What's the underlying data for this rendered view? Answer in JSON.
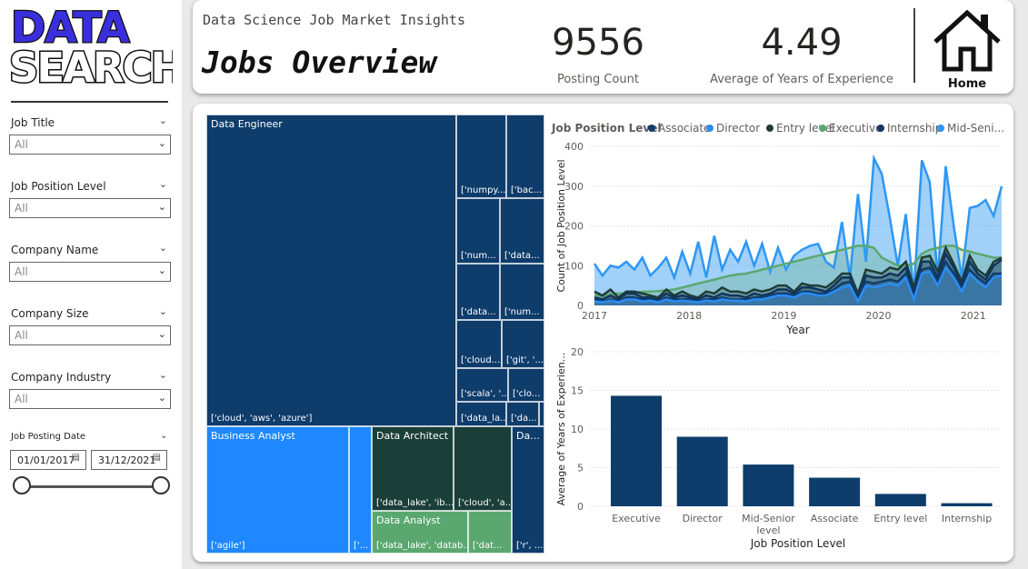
{
  "logo": {
    "line1": "DATA",
    "line2": "SEARCH"
  },
  "filters": {
    "job_title": {
      "label": "Job Title",
      "value": "All"
    },
    "position_level": {
      "label": "Job Position Level",
      "value": "All"
    },
    "company_name": {
      "label": "Company Name",
      "value": "All"
    },
    "company_size": {
      "label": "Company Size",
      "value": "All"
    },
    "company_industry": {
      "label": "Company Industry",
      "value": "All"
    },
    "posting_date": {
      "label": "Job Posting Date",
      "start": "01/01/2017",
      "end": "31/12/2021",
      "range_fraction": [
        0,
        1
      ]
    }
  },
  "header": {
    "subtitle": "Data Science Job Market Insights",
    "title": "Jobs Overview",
    "kpi_count": {
      "value": "9556",
      "label": "Posting Count"
    },
    "kpi_exp": {
      "value": "4.49",
      "label": "Average of Years of Experience"
    },
    "home_label": "Home"
  },
  "treemap": {
    "colors": {
      "navy": "#0e3c6b",
      "blue": "#1f88ff",
      "dark_green": "#1a3f38",
      "green": "#5aa86f"
    },
    "tiles": [
      {
        "label": "Data Engineer",
        "text": "['cloud', 'aws', 'azure']"
      },
      {
        "label": "",
        "text": "['numpy..."
      },
      {
        "label": "",
        "text": "['bac..."
      },
      {
        "label": "",
        "text": "['num..."
      },
      {
        "label": "",
        "text": "['data..."
      },
      {
        "label": "",
        "text": "['data..."
      },
      {
        "label": "",
        "text": "['num..."
      },
      {
        "label": "",
        "text": "['cloud..."
      },
      {
        "label": "",
        "text": "['git', '..."
      },
      {
        "label": "",
        "text": "['scala', '..."
      },
      {
        "label": "",
        "text": "['clo..."
      },
      {
        "label": "",
        "text": "['data_la..."
      },
      {
        "label": "",
        "text": "['da..."
      },
      {
        "label": "Business Analyst",
        "text": "['agile']"
      },
      {
        "label": "",
        "text": "['..."
      },
      {
        "label": "Data Architect",
        "text": "['data_lake', 'ib..."
      },
      {
        "label": "",
        "text": "['cloud', 'a..."
      },
      {
        "label": "Data Analyst",
        "text": "['data_lake', 'datab..."
      },
      {
        "label": "",
        "text": "['dat..."
      },
      {
        "label": "Da...",
        "text": "['r', ..."
      }
    ]
  },
  "line_chart": {
    "legend_title": "Job Position Level",
    "legend": [
      {
        "name": "Associate",
        "color": "#0f3e6d"
      },
      {
        "name": "Director",
        "color": "#2b8df4"
      },
      {
        "name": "Entry level",
        "color": "#1f3d37"
      },
      {
        "name": "Executive",
        "color": "#5aa86f"
      },
      {
        "name": "Internship",
        "color": "#12355e"
      },
      {
        "name": "Mid-Seni...",
        "color": "#2e97f2"
      }
    ]
  },
  "chart_data": [
    {
      "type": "area",
      "title": "",
      "xlabel": "Year",
      "ylabel": "Count of Job Position Level",
      "x_ticks": [
        "2017",
        "2018",
        "2019",
        "2020",
        "2021"
      ],
      "ylim": [
        0,
        400
      ],
      "y_ticks": [
        0,
        100,
        200,
        300,
        400
      ],
      "series": [
        {
          "name": "Mid-Seni...",
          "color": "#2e97f2",
          "values": [
            105,
            75,
            100,
            95,
            110,
            90,
            120,
            75,
            95,
            120,
            70,
            135,
            80,
            160,
            70,
            175,
            90,
            140,
            110,
            160,
            100,
            155,
            85,
            145,
            90,
            125,
            140,
            150,
            155,
            110,
            95,
            210,
            70,
            280,
            110,
            370,
            330,
            220,
            100,
            230,
            30,
            365,
            310,
            70,
            350,
            200,
            70,
            245,
            250,
            265,
            225,
            300
          ]
        },
        {
          "name": "Executive",
          "color": "#5aa86f",
          "values": [
            25,
            25,
            28,
            30,
            30,
            32,
            34,
            35,
            36,
            38,
            40,
            45,
            50,
            55,
            60,
            65,
            70,
            75,
            78,
            80,
            85,
            90,
            95,
            100,
            105,
            110,
            115,
            120,
            125,
            130,
            135,
            140,
            145,
            150,
            150,
            145,
            120,
            110,
            100,
            100,
            105,
            130,
            140,
            145,
            150,
            150,
            140,
            135,
            130,
            125,
            120,
            120
          ]
        },
        {
          "name": "Entry level",
          "color": "#1f3d37",
          "values": [
            35,
            25,
            40,
            20,
            35,
            35,
            30,
            25,
            20,
            40,
            25,
            35,
            25,
            20,
            35,
            30,
            45,
            35,
            35,
            30,
            40,
            35,
            40,
            50,
            50,
            35,
            55,
            50,
            50,
            45,
            60,
            80,
            80,
            30,
            90,
            85,
            80,
            95,
            90,
            110,
            45,
            120,
            125,
            85,
            145,
            105,
            60,
            125,
            90,
            75,
            110,
            120
          ]
        },
        {
          "name": "Internship",
          "color": "#12355e",
          "values": [
            20,
            15,
            25,
            15,
            30,
            30,
            20,
            20,
            15,
            30,
            20,
            25,
            20,
            15,
            25,
            20,
            30,
            25,
            25,
            20,
            30,
            25,
            30,
            40,
            40,
            30,
            45,
            45,
            40,
            35,
            50,
            70,
            70,
            20,
            75,
            70,
            70,
            80,
            75,
            95,
            30,
            110,
            110,
            70,
            130,
            95,
            50,
            110,
            80,
            65,
            100,
            115
          ]
        },
        {
          "name": "Associate",
          "color": "#0f3e6d",
          "values": [
            15,
            10,
            15,
            10,
            20,
            20,
            15,
            15,
            10,
            20,
            15,
            15,
            15,
            10,
            15,
            15,
            20,
            15,
            15,
            15,
            20,
            20,
            25,
            30,
            30,
            25,
            35,
            35,
            30,
            30,
            40,
            55,
            60,
            15,
            60,
            55,
            60,
            65,
            60,
            80,
            20,
            90,
            95,
            60,
            110,
            80,
            40,
            90,
            70,
            55,
            80,
            80
          ]
        },
        {
          "name": "Director",
          "color": "#2b8df4",
          "values": [
            10,
            8,
            12,
            8,
            15,
            15,
            10,
            12,
            8,
            15,
            10,
            12,
            10,
            8,
            12,
            10,
            15,
            12,
            12,
            10,
            15,
            15,
            20,
            25,
            25,
            20,
            30,
            30,
            25,
            25,
            35,
            45,
            50,
            10,
            50,
            45,
            50,
            55,
            50,
            70,
            15,
            80,
            85,
            50,
            95,
            70,
            35,
            80,
            60,
            45,
            70,
            75
          ]
        }
      ]
    },
    {
      "type": "bar",
      "title": "",
      "xlabel": "Job Position Level",
      "ylabel": "Average of Years of Experien...",
      "categories": [
        "Executive",
        "Director",
        "Mid-Senior level",
        "Associate",
        "Entry level",
        "Internship"
      ],
      "values": [
        14.3,
        9.0,
        5.4,
        3.7,
        1.6,
        0.4
      ],
      "ylim": [
        0,
        20
      ],
      "y_ticks": [
        0,
        5,
        10,
        15,
        20
      ],
      "color": "#0e3c6b"
    }
  ]
}
